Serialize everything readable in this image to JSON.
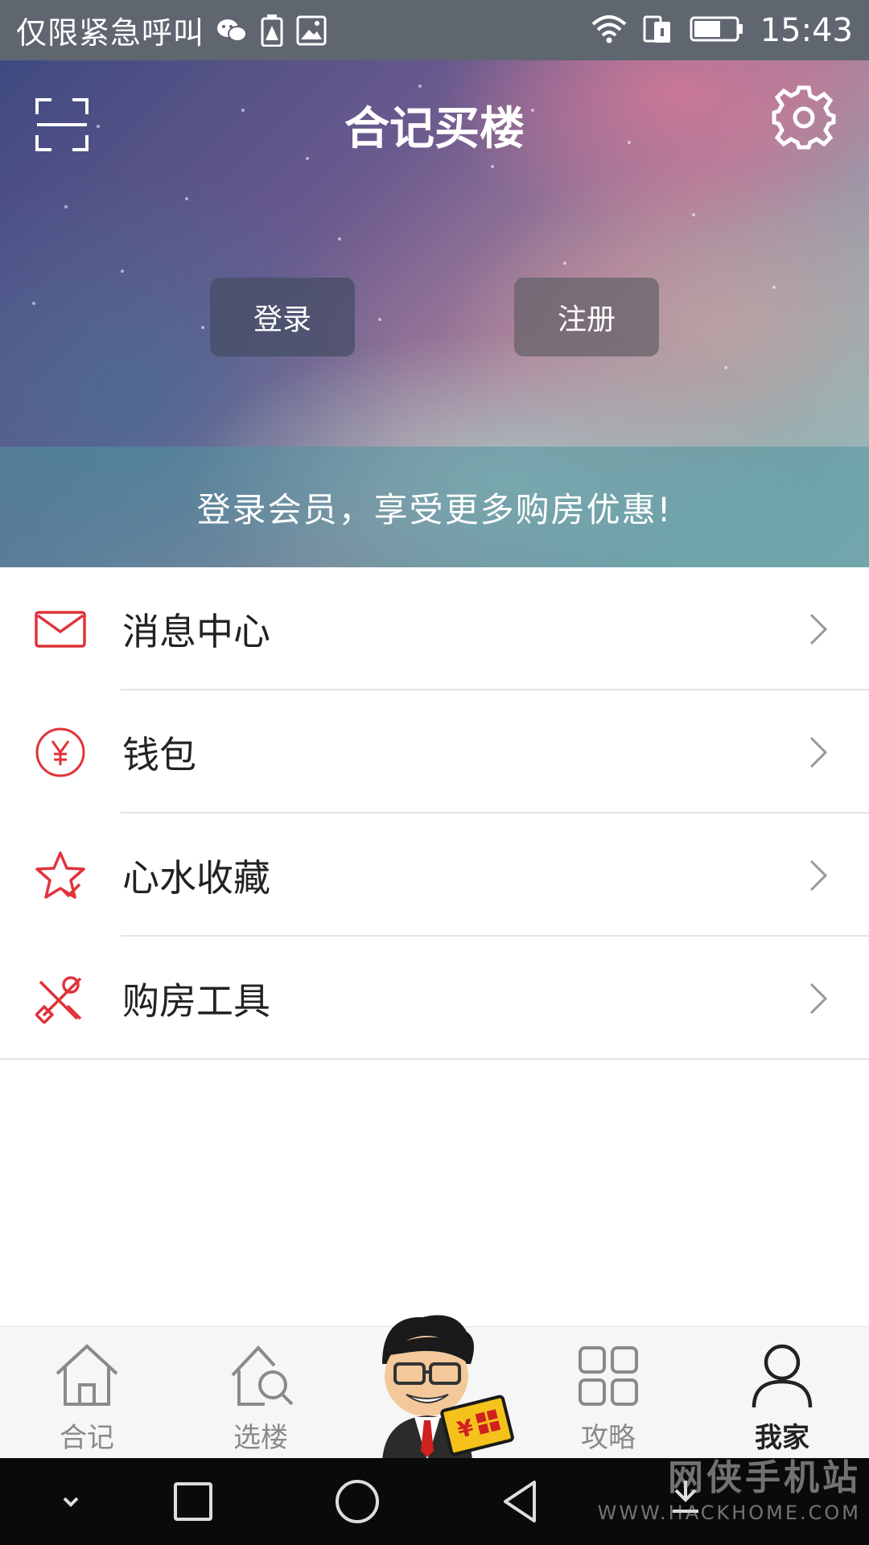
{
  "status_bar": {
    "carrier_text": "仅限紧急呼叫",
    "time": "15:43",
    "icons": [
      "wechat-icon",
      "battery-warning-icon",
      "image-icon",
      "wifi-icon",
      "dual-sim-icon",
      "battery-icon"
    ]
  },
  "header": {
    "title": "合记买楼",
    "left_icon": "scan-icon",
    "right_icon": "gear-icon"
  },
  "auth": {
    "login_label": "登录",
    "register_label": "注册",
    "promo_text": "登录会员，享受更多购房优惠!"
  },
  "menu": {
    "items": [
      {
        "label": "消息中心",
        "icon": "mail-icon"
      },
      {
        "label": "钱包",
        "icon": "yen-coin-icon"
      },
      {
        "label": "心水收藏",
        "icon": "star-check-icon"
      },
      {
        "label": "购房工具",
        "icon": "tools-icon"
      }
    ]
  },
  "bottom_nav": {
    "items": [
      {
        "label": "合记",
        "icon": "home-icon",
        "active": false
      },
      {
        "label": "选楼",
        "icon": "house-search-icon",
        "active": false
      },
      {
        "label": "攻略",
        "icon": "grid-icon",
        "active": false
      },
      {
        "label": "我家",
        "icon": "person-icon",
        "active": true
      }
    ],
    "center_icon": "mascot-icon"
  },
  "watermark": {
    "title": "网侠手机站",
    "url": "WWW.HACKHOME.COM"
  },
  "colors": {
    "accent": "#e0333a",
    "status_bar": "#5f6670",
    "nav_active": "#222222",
    "nav_inactive": "#8a8a8a"
  }
}
